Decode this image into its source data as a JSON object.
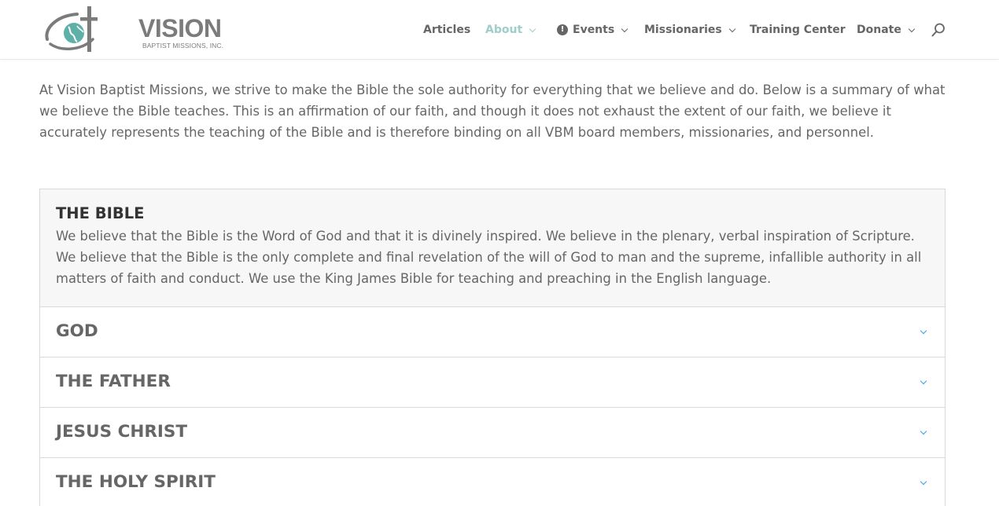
{
  "logo": {
    "word": "VISION",
    "subtitle": "BAPTIST MISSIONS, INC."
  },
  "nav": {
    "items": [
      {
        "label": "Articles",
        "dropdown": false,
        "active": false
      },
      {
        "label": "About",
        "dropdown": true,
        "active": true
      },
      {
        "label": "Events",
        "dropdown": true,
        "active": false,
        "icon": "alert-circle-icon"
      },
      {
        "label": "Missionaries",
        "dropdown": true,
        "active": false
      },
      {
        "label": "Training Center",
        "dropdown": false,
        "active": false
      },
      {
        "label": "Donate",
        "dropdown": true,
        "active": false
      }
    ],
    "search_icon": "search-icon"
  },
  "intro": "At Vision Baptist Missions, we strive to make the Bible the sole authority for everything that we believe and do. Below is a summary of what we believe the Bible teaches. This is an affirmation of our faith, and though it does not exhaust the extent of our faith, we believe it accurately represents the teaching of the Bible and is therefore binding on all VBM board members, missionaries, and personnel.",
  "accordion": {
    "open": {
      "title": "THE BIBLE",
      "body": "We believe that the Bible is the Word of God and that it is divinely inspired. We believe in the plenary, verbal inspiration of Scripture. We believe that the Bible is the only complete and final revelation of the will of God to man and the supreme, infallible authority in all matters of faith and conduct. We use the King James Bible for teaching and preaching in the English language."
    },
    "closed": [
      {
        "title": "GOD"
      },
      {
        "title": "THE FATHER"
      },
      {
        "title": "JESUS CHRIST"
      },
      {
        "title": "THE HOLY SPIRIT"
      }
    ]
  },
  "colors": {
    "active_nav": "#9fcdc8",
    "text": "#666666",
    "heading": "#333333",
    "toggle": "#2ea3f2",
    "panel_bg": "#f7f7f7",
    "border": "#d9d9d9"
  }
}
